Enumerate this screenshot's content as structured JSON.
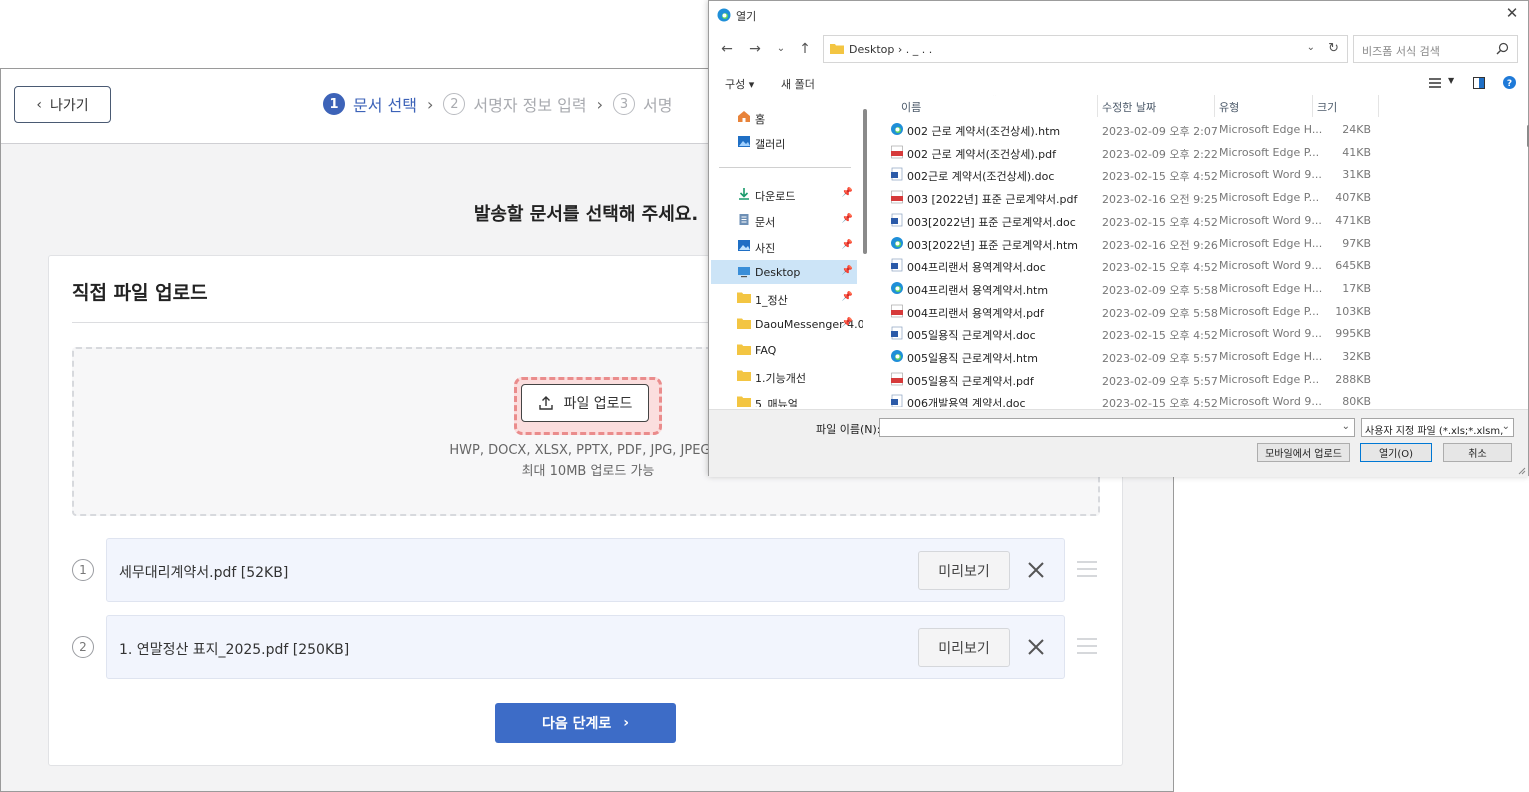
{
  "app": {
    "back_label": "나가기",
    "steps": [
      {
        "num": "1",
        "label": "문서 선택"
      },
      {
        "num": "2",
        "label": "서명자 정보 입력"
      },
      {
        "num": "3",
        "label": "서명"
      }
    ],
    "heading": "발송할 문서를 선택해 주세요.",
    "card_title": "직접 파일 업로드",
    "upload_label": "파일 업로드",
    "formats_text": "HWP, DOCX, XLSX, PPTX, PDF, JPG, JPEG, P",
    "max_size_text": "최대 10MB 업로드 가능",
    "files": [
      {
        "index": "1",
        "name": "세무대리계약서.pdf  [52KB]",
        "preview_label": "미리보기"
      },
      {
        "index": "2",
        "name": "1. 연말정산 표지_2025.pdf  [250KB]",
        "preview_label": "미리보기"
      }
    ],
    "next_label": "다음 단계로",
    "colors": {
      "accent": "#3d6cc7",
      "step_active": "#3d63b8",
      "highlight": "#ea8c8c"
    }
  },
  "dialog": {
    "title": "열기",
    "path": "Desktop  ›   .  _  .  .",
    "search_placeholder": "비즈폼 서식 검색",
    "tools": {
      "organize": "구성 ▾",
      "new_folder": "새 폴더"
    },
    "sidebar": [
      {
        "label": "홈",
        "icon": "home-icon"
      },
      {
        "label": "갤러리",
        "icon": "gallery-icon"
      },
      {
        "label": "다운로드",
        "icon": "download-icon",
        "pinned": true
      },
      {
        "label": "문서",
        "icon": "documents-icon",
        "pinned": true
      },
      {
        "label": "사진",
        "icon": "pictures-icon",
        "pinned": true
      },
      {
        "label": "Desktop",
        "icon": "desktop-icon",
        "pinned": true,
        "selected": true
      },
      {
        "label": "1_정산",
        "icon": "folder-icon",
        "pinned": true
      },
      {
        "label": "DaouMessenger 4.0",
        "icon": "folder-icon",
        "pinned": true
      },
      {
        "label": "FAQ",
        "icon": "folder-icon"
      },
      {
        "label": "1.기능개선",
        "icon": "folder-icon"
      },
      {
        "label": "5_매뉴얼",
        "icon": "folder-icon"
      }
    ],
    "columns": {
      "name": "이름",
      "date": "수정한 날짜",
      "type": "유형",
      "size": "크기"
    },
    "files": [
      {
        "name": "002 근로 계약서(조건상세).htm",
        "date": "2023-02-09 오후 2:07",
        "type": "Microsoft Edge H...",
        "size": "24KB",
        "kind": "edge"
      },
      {
        "name": "002 근로 계약서(조건상세).pdf",
        "date": "2023-02-09 오후 2:22",
        "type": "Microsoft Edge P...",
        "size": "41KB",
        "kind": "pdf"
      },
      {
        "name": "002근로 계약서(조건상세).doc",
        "date": "2023-02-15 오후 4:52",
        "type": "Microsoft Word 9...",
        "size": "31KB",
        "kind": "word"
      },
      {
        "name": "003 [2022년] 표준 근로계약서.pdf",
        "date": "2023-02-16 오전 9:25",
        "type": "Microsoft Edge P...",
        "size": "407KB",
        "kind": "pdf"
      },
      {
        "name": "003[2022년] 표준 근로계약서.doc",
        "date": "2023-02-15 오후 4:52",
        "type": "Microsoft Word 9...",
        "size": "471KB",
        "kind": "word"
      },
      {
        "name": "003[2022년] 표준 근로계약서.htm",
        "date": "2023-02-16 오전 9:26",
        "type": "Microsoft Edge H...",
        "size": "97KB",
        "kind": "edge"
      },
      {
        "name": "004프리랜서 용역계약서.doc",
        "date": "2023-02-15 오후 4:52",
        "type": "Microsoft Word 9...",
        "size": "645KB",
        "kind": "word"
      },
      {
        "name": "004프리랜서 용역계약서.htm",
        "date": "2023-02-09 오후 5:58",
        "type": "Microsoft Edge H...",
        "size": "17KB",
        "kind": "edge"
      },
      {
        "name": "004프리랜서 용역계약서.pdf",
        "date": "2023-02-09 오후 5:58",
        "type": "Microsoft Edge P...",
        "size": "103KB",
        "kind": "pdf"
      },
      {
        "name": "005일용직 근로계약서.doc",
        "date": "2023-02-15 오후 4:52",
        "type": "Microsoft Word 9...",
        "size": "995KB",
        "kind": "word"
      },
      {
        "name": "005일용직 근로계약서.htm",
        "date": "2023-02-09 오후 5:57",
        "type": "Microsoft Edge H...",
        "size": "32KB",
        "kind": "edge"
      },
      {
        "name": "005일용직 근로계약서.pdf",
        "date": "2023-02-09 오후 5:57",
        "type": "Microsoft Edge P...",
        "size": "288KB",
        "kind": "pdf"
      },
      {
        "name": "006개발용역 계약서.doc",
        "date": "2023-02-15 오후 4:52",
        "type": "Microsoft Word 9...",
        "size": "80KB",
        "kind": "word"
      }
    ],
    "filename_label": "파일 이름(N):",
    "filename_value": "",
    "filetype": "사용자 지정 파일 (*.xls;*.xlsm;*",
    "buttons": {
      "mobile": "모바일에서 업로드",
      "open": "열기(O)",
      "cancel": "취소"
    }
  }
}
